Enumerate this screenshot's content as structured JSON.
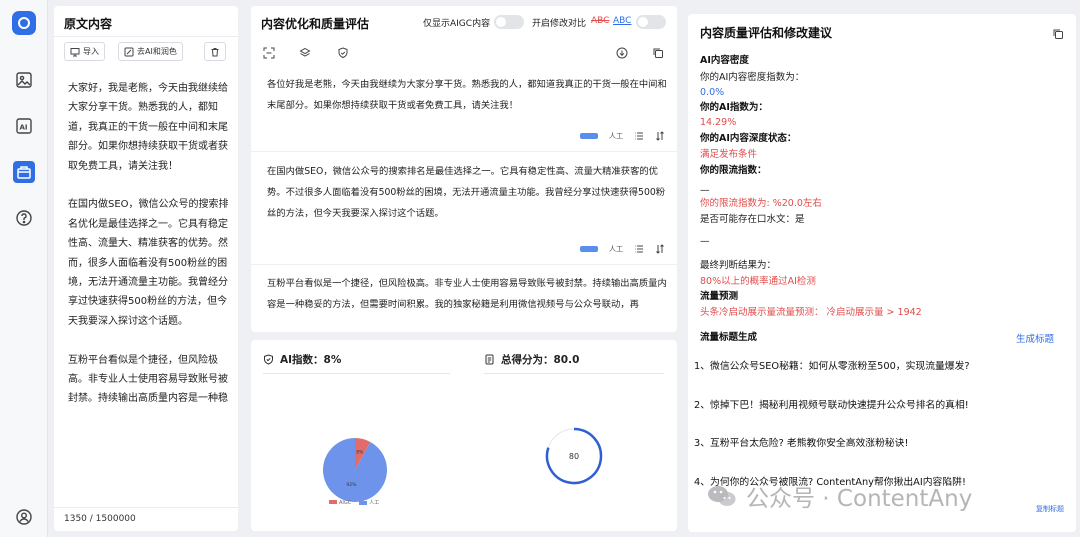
{
  "sidebar": {
    "icons": [
      "logo-icon",
      "image-icon",
      "ai-icon",
      "toolbox-icon",
      "help-icon",
      "user-icon"
    ]
  },
  "original": {
    "title": "原文内容",
    "buttons": {
      "import": "导入",
      "remove_ai": "去AI和润色"
    },
    "paragraphs": [
      "大家好，我是老熊，今天由我继续给大家分享干货。熟悉我的人，都知道，我真正的干货一般在中间和末尾部分。如果你想持续获取干货或者获取免费工具，请关注我！",
      "在国内做SEO，微信公众号的搜索排名优化是最佳选择之一。它具有稳定性高、流量大、精准获客的优势。然而，很多人面临着没有500粉丝的困境，无法开通流量主功能。我曾经分享过快速获得500粉丝的方法，但今天我要深入探讨这个话题。",
      "互粉平台看似是个捷径，但风险极高。非专业人士使用容易导致账号被封禁。持续输出高质量内容是一种稳妥的方法，但需要时间积累。我的独家秘籍是利用微信视频号与公众号联动，再以公众号进行实现"
    ],
    "counter": "1350 / 1500000"
  },
  "optimize": {
    "title": "内容优化和质量评估",
    "only_aigc_label": "仅显示AIGC内容",
    "compare_label": "开启修改对比",
    "abc_deleted": "ABC",
    "abc_inserted": "ABC",
    "paragraphs": [
      "各位好我是老熊，今天由我继续为大家分享干货。熟悉我的人，都知道我真正的干货一般在中间和末尾部分。如果你想持续获取干货或者免费工具，请关注我！",
      "在国内做SEO，微信公众号的搜索排名是最佳选择之一。它具有稳定性高、流量大精准获客的优势。不过很多人面临着没有500粉丝的困境，无法开通流量主功能。我曾经分享过快速获得500粉丝的方法，但今天我要深入探讨这个话题。",
      "互粉平台看似是一个捷径，但风险极高。非专业人士使用容易导致账号被封禁。持续输出高质量内容是一种稳妥的方法，但需要时间积累。我的独家秘籍是利用微信视频号与公众号联动，再"
    ],
    "para_tag": "人工"
  },
  "scores": {
    "ai_index_label": "AI指数：8%",
    "total_score_label": "总得分为：80.0",
    "legend_aigc": "AIGC",
    "legend_human": "人工",
    "pie_small_label": "8%",
    "pie_big_label": "92%",
    "gauge_value_text": "80"
  },
  "chart_data": [
    {
      "type": "pie",
      "categories": [
        "AIGC",
        "人工"
      ],
      "values": [
        8,
        92
      ],
      "colors": [
        "#e46b6b",
        "#6e93ea"
      ]
    },
    {
      "type": "gauge",
      "value": 80,
      "max": 100,
      "color": "#2f5fd3"
    }
  ],
  "quality": {
    "title": "内容质量评估和修改建议",
    "density_heading": "AI内容密度",
    "density_text": "你的AI内容密度指数为：",
    "density_value": "0.0%",
    "ai_index_heading": "你的AI指数为：",
    "ai_index_value": "14.29%",
    "depth_heading": "你的AI内容深度状态：",
    "depth_value": "满足发布条件",
    "limit_heading": "你的限流指数：",
    "dash1": "—",
    "limit_value": "你的限流指数为: %20.0左右",
    "kouhuo": "是否可能存在口水文：是",
    "dash2": "—",
    "final_label": "最终判断结果为：",
    "final_value": "80%以上的概率通过AI检测",
    "traffic_heading": "流量预测",
    "traffic_value": "头条冷启动展示量流量预测： 冷启动展示量 > 1942"
  },
  "titles": {
    "title": "流量标题生成",
    "generate_link": "生成标题",
    "items": [
      "1、微信公众号SEO秘籍：如何从零涨粉至500，实现流量爆发?",
      "2、惊掉下巴！揭秘利用视频号联动快速提升公众号排名的真相!",
      "3、互粉平台太危险? 老熊教你安全高效涨粉秘诀!",
      "4、为何你的公众号被限流? ContentAny帮你揪出AI内容陷阱!"
    ],
    "copy_link": "复制标题"
  },
  "watermark": "公众号 · ContentAny"
}
